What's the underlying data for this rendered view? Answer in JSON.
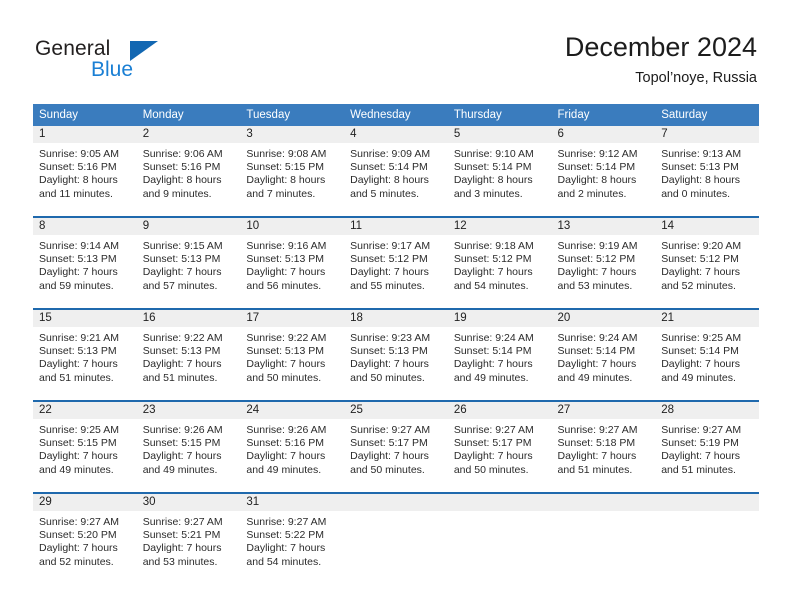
{
  "brand": {
    "name_top": "General",
    "name_bottom": "Blue",
    "triangle_color": "#1267b2",
    "blue_color": "#1a7fd4"
  },
  "header": {
    "title": "December 2024",
    "subtitle": "Topol’noye, Russia"
  },
  "theme": {
    "header_bg": "#3a7cbe",
    "header_text": "#ffffff",
    "separator": "#1f69ad",
    "daynum_bg": "#efefef",
    "page_bg": "#ffffff"
  },
  "weekdays": [
    "Sunday",
    "Monday",
    "Tuesday",
    "Wednesday",
    "Thursday",
    "Friday",
    "Saturday"
  ],
  "weeks": [
    [
      {
        "day": "1",
        "sunrise": "Sunrise: 9:05 AM",
        "sunset": "Sunset: 5:16 PM",
        "daylight": "Daylight: 8 hours and 11 minutes."
      },
      {
        "day": "2",
        "sunrise": "Sunrise: 9:06 AM",
        "sunset": "Sunset: 5:16 PM",
        "daylight": "Daylight: 8 hours and 9 minutes."
      },
      {
        "day": "3",
        "sunrise": "Sunrise: 9:08 AM",
        "sunset": "Sunset: 5:15 PM",
        "daylight": "Daylight: 8 hours and 7 minutes."
      },
      {
        "day": "4",
        "sunrise": "Sunrise: 9:09 AM",
        "sunset": "Sunset: 5:14 PM",
        "daylight": "Daylight: 8 hours and 5 minutes."
      },
      {
        "day": "5",
        "sunrise": "Sunrise: 9:10 AM",
        "sunset": "Sunset: 5:14 PM",
        "daylight": "Daylight: 8 hours and 3 minutes."
      },
      {
        "day": "6",
        "sunrise": "Sunrise: 9:12 AM",
        "sunset": "Sunset: 5:14 PM",
        "daylight": "Daylight: 8 hours and 2 minutes."
      },
      {
        "day": "7",
        "sunrise": "Sunrise: 9:13 AM",
        "sunset": "Sunset: 5:13 PM",
        "daylight": "Daylight: 8 hours and 0 minutes."
      }
    ],
    [
      {
        "day": "8",
        "sunrise": "Sunrise: 9:14 AM",
        "sunset": "Sunset: 5:13 PM",
        "daylight": "Daylight: 7 hours and 59 minutes."
      },
      {
        "day": "9",
        "sunrise": "Sunrise: 9:15 AM",
        "sunset": "Sunset: 5:13 PM",
        "daylight": "Daylight: 7 hours and 57 minutes."
      },
      {
        "day": "10",
        "sunrise": "Sunrise: 9:16 AM",
        "sunset": "Sunset: 5:13 PM",
        "daylight": "Daylight: 7 hours and 56 minutes."
      },
      {
        "day": "11",
        "sunrise": "Sunrise: 9:17 AM",
        "sunset": "Sunset: 5:12 PM",
        "daylight": "Daylight: 7 hours and 55 minutes."
      },
      {
        "day": "12",
        "sunrise": "Sunrise: 9:18 AM",
        "sunset": "Sunset: 5:12 PM",
        "daylight": "Daylight: 7 hours and 54 minutes."
      },
      {
        "day": "13",
        "sunrise": "Sunrise: 9:19 AM",
        "sunset": "Sunset: 5:12 PM",
        "daylight": "Daylight: 7 hours and 53 minutes."
      },
      {
        "day": "14",
        "sunrise": "Sunrise: 9:20 AM",
        "sunset": "Sunset: 5:12 PM",
        "daylight": "Daylight: 7 hours and 52 minutes."
      }
    ],
    [
      {
        "day": "15",
        "sunrise": "Sunrise: 9:21 AM",
        "sunset": "Sunset: 5:13 PM",
        "daylight": "Daylight: 7 hours and 51 minutes."
      },
      {
        "day": "16",
        "sunrise": "Sunrise: 9:22 AM",
        "sunset": "Sunset: 5:13 PM",
        "daylight": "Daylight: 7 hours and 51 minutes."
      },
      {
        "day": "17",
        "sunrise": "Sunrise: 9:22 AM",
        "sunset": "Sunset: 5:13 PM",
        "daylight": "Daylight: 7 hours and 50 minutes."
      },
      {
        "day": "18",
        "sunrise": "Sunrise: 9:23 AM",
        "sunset": "Sunset: 5:13 PM",
        "daylight": "Daylight: 7 hours and 50 minutes."
      },
      {
        "day": "19",
        "sunrise": "Sunrise: 9:24 AM",
        "sunset": "Sunset: 5:14 PM",
        "daylight": "Daylight: 7 hours and 49 minutes."
      },
      {
        "day": "20",
        "sunrise": "Sunrise: 9:24 AM",
        "sunset": "Sunset: 5:14 PM",
        "daylight": "Daylight: 7 hours and 49 minutes."
      },
      {
        "day": "21",
        "sunrise": "Sunrise: 9:25 AM",
        "sunset": "Sunset: 5:14 PM",
        "daylight": "Daylight: 7 hours and 49 minutes."
      }
    ],
    [
      {
        "day": "22",
        "sunrise": "Sunrise: 9:25 AM",
        "sunset": "Sunset: 5:15 PM",
        "daylight": "Daylight: 7 hours and 49 minutes."
      },
      {
        "day": "23",
        "sunrise": "Sunrise: 9:26 AM",
        "sunset": "Sunset: 5:15 PM",
        "daylight": "Daylight: 7 hours and 49 minutes."
      },
      {
        "day": "24",
        "sunrise": "Sunrise: 9:26 AM",
        "sunset": "Sunset: 5:16 PM",
        "daylight": "Daylight: 7 hours and 49 minutes."
      },
      {
        "day": "25",
        "sunrise": "Sunrise: 9:27 AM",
        "sunset": "Sunset: 5:17 PM",
        "daylight": "Daylight: 7 hours and 50 minutes."
      },
      {
        "day": "26",
        "sunrise": "Sunrise: 9:27 AM",
        "sunset": "Sunset: 5:17 PM",
        "daylight": "Daylight: 7 hours and 50 minutes."
      },
      {
        "day": "27",
        "sunrise": "Sunrise: 9:27 AM",
        "sunset": "Sunset: 5:18 PM",
        "daylight": "Daylight: 7 hours and 51 minutes."
      },
      {
        "day": "28",
        "sunrise": "Sunrise: 9:27 AM",
        "sunset": "Sunset: 5:19 PM",
        "daylight": "Daylight: 7 hours and 51 minutes."
      }
    ],
    [
      {
        "day": "29",
        "sunrise": "Sunrise: 9:27 AM",
        "sunset": "Sunset: 5:20 PM",
        "daylight": "Daylight: 7 hours and 52 minutes."
      },
      {
        "day": "30",
        "sunrise": "Sunrise: 9:27 AM",
        "sunset": "Sunset: 5:21 PM",
        "daylight": "Daylight: 7 hours and 53 minutes."
      },
      {
        "day": "31",
        "sunrise": "Sunrise: 9:27 AM",
        "sunset": "Sunset: 5:22 PM",
        "daylight": "Daylight: 7 hours and 54 minutes."
      },
      {
        "day": "",
        "sunrise": "",
        "sunset": "",
        "daylight": ""
      },
      {
        "day": "",
        "sunrise": "",
        "sunset": "",
        "daylight": ""
      },
      {
        "day": "",
        "sunrise": "",
        "sunset": "",
        "daylight": ""
      },
      {
        "day": "",
        "sunrise": "",
        "sunset": "",
        "daylight": ""
      }
    ]
  ]
}
